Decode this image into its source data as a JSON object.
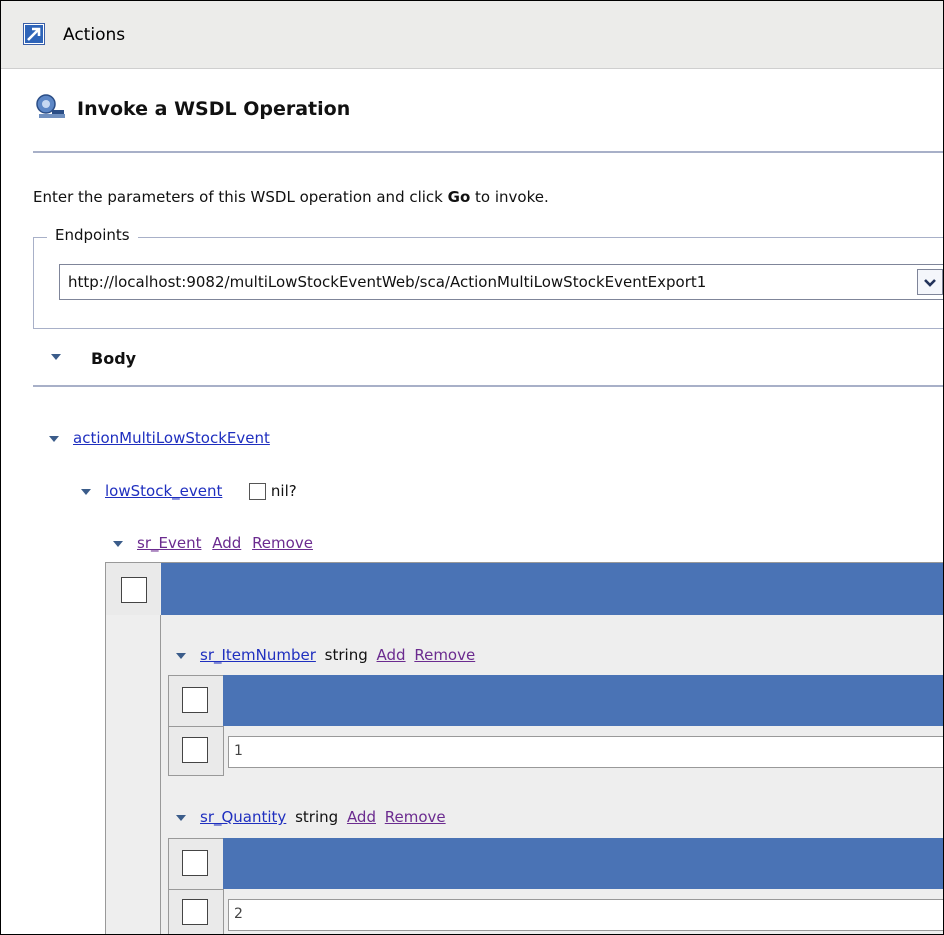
{
  "title_bar": {
    "title": "Actions",
    "icon": "actions-arrow-icon"
  },
  "heading": {
    "title": "Invoke a WSDL Operation",
    "icon": "wsdl-operation-icon"
  },
  "intro": {
    "prefix": "Enter the parameters of this WSDL operation and click ",
    "bold": "Go",
    "suffix": " to invoke."
  },
  "endpoints": {
    "legend": "Endpoints",
    "selected": "http://localhost:9082/multiLowStockEventWeb/sca/ActionMultiLowStockEventExport1"
  },
  "body_section": {
    "label": "Body"
  },
  "tree": {
    "operation": "actionMultiLowStockEvent",
    "event": {
      "name": "lowStock_event",
      "nil_label": "nil?"
    },
    "sr_event": {
      "name": "sr_Event",
      "add": "Add",
      "remove": "Remove"
    },
    "item_number": {
      "name": "sr_ItemNumber",
      "type": "string",
      "add": "Add",
      "remove": "Remove",
      "value": "1"
    },
    "quantity": {
      "name": "sr_Quantity",
      "type": "string",
      "add": "Add",
      "remove": "Remove",
      "value": "2"
    }
  },
  "colors": {
    "header_bar": "#4a73b5",
    "link": "#1f2fbf",
    "visited_link": "#6b2b8f",
    "rule": "#a8b0c8"
  }
}
